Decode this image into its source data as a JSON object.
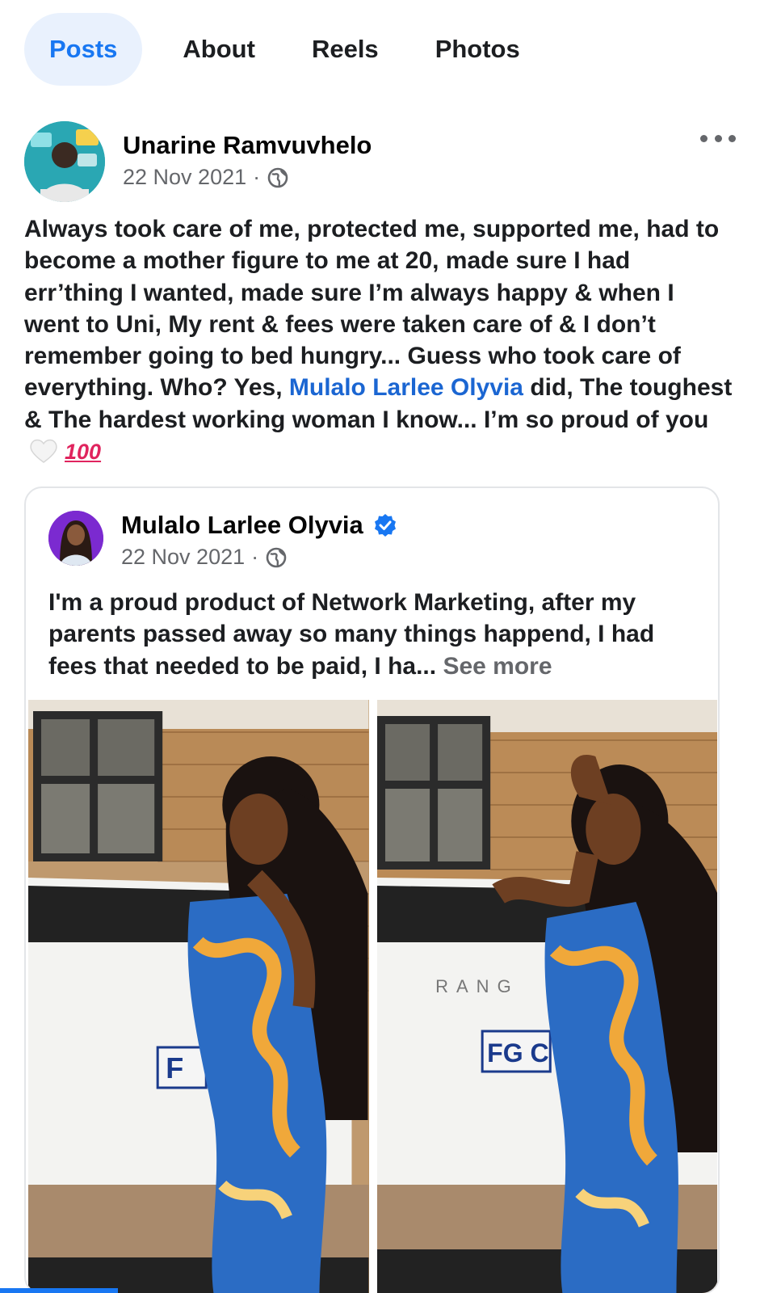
{
  "tabs": [
    {
      "label": "Posts",
      "active": true
    },
    {
      "label": "About"
    },
    {
      "label": "Reels"
    },
    {
      "label": "Photos"
    }
  ],
  "post": {
    "author": "Unarine Ramvuvhelo",
    "date": "22 Nov 2021",
    "separator": "·",
    "privacy_icon": "globe-icon",
    "text_before_mention": "Always took care of me, protected me, supported me, had to become a mother figure to me at 20, made sure I had err’thing I wanted, made sure I’m always happy & when I went to Uni, My rent & fees were taken care of & I don’t remember going to bed hungry... Guess who took care of everything. Who? Yes, ",
    "mention": "Mulalo Larlee Olyvia",
    "text_after_mention": " did, The toughest & The hardest working woman I know... I’m so proud of you",
    "emoji_100": "100"
  },
  "shared": {
    "author": "Mulalo Larlee Olyvia",
    "verified": true,
    "date": "22 Nov 2021",
    "separator": "·",
    "text": "I'm a proud product of Network Marketing, after my parents passed away so many things happend, I had fees that needed to be paid, I ha... ",
    "see_more": "See more",
    "photos": [
      {
        "plate": "F"
      },
      {
        "plate": "FG C",
        "badge": "RANG"
      }
    ]
  },
  "colors": {
    "accent": "#1877f2",
    "mention": "#1b66d2",
    "secondary_text": "#65676b"
  }
}
